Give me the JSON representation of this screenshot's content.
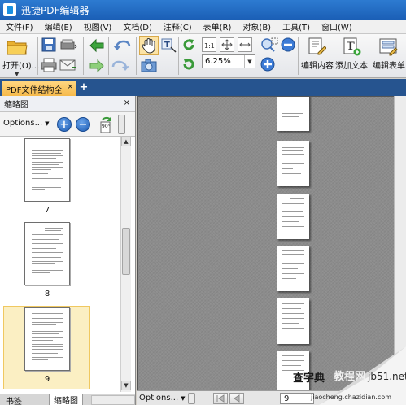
{
  "window": {
    "title": "迅捷PDF编辑器"
  },
  "menu": [
    "文件(F)",
    "编辑(E)",
    "视图(V)",
    "文档(D)",
    "注释(C)",
    "表单(R)",
    "对象(B)",
    "工具(T)",
    "窗口(W)"
  ],
  "toolbar": {
    "open_label": "打开(O)...",
    "zoom_value": "6.25%",
    "edit_content_label": "编辑内容",
    "add_text_label": "添加文本",
    "edit_form_label": "编辑表单"
  },
  "tabs": {
    "document_tab": "PDF文件结构全",
    "close_symbol": "×",
    "add_symbol": "+"
  },
  "panel": {
    "title": "缩略图",
    "close_symbol": "×",
    "options_label": "Options...",
    "zoom_in_symbol": "+",
    "zoom_out_symbol": "−",
    "rotate_label": "90°",
    "thumbnails": [
      {
        "label": "7"
      },
      {
        "label": "8"
      },
      {
        "label": "9"
      }
    ],
    "bottom_tabs": [
      "书签",
      "缩略图"
    ]
  },
  "status": {
    "options_label": "Options...",
    "page_number": "9"
  },
  "watermark": {
    "site_cn": "查字典",
    "site_en": "jb51.net",
    "brand": "教程网",
    "url": "jiaocheng.chazidian.com"
  },
  "colors": {
    "title_bar": "#1b5fb6",
    "tab_bar": "#26548f",
    "active_tab": "#f5b94a",
    "selected_thumb": "#fbefc3",
    "canvas": "#8c8c8c"
  }
}
